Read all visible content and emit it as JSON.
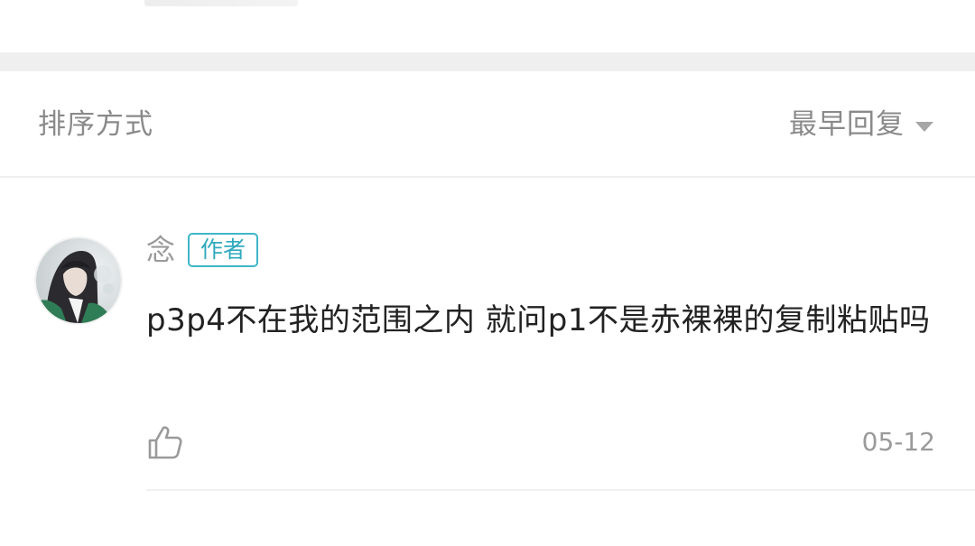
{
  "sort_bar": {
    "label": "排序方式",
    "selected": "最早回复",
    "dropdown_icon": "caret-down-icon"
  },
  "comment": {
    "author": "念",
    "badge": "作者",
    "text": "p3p4不在我的范围之内 就问p1不是赤裸裸的复制粘贴吗",
    "date": "05-12",
    "like_icon": "thumbs-up-icon",
    "avatar": "avatar-image"
  },
  "colors": {
    "badge_border": "#3fb6c9",
    "muted_text": "#8a8a8a",
    "section_gap": "#efefef"
  }
}
